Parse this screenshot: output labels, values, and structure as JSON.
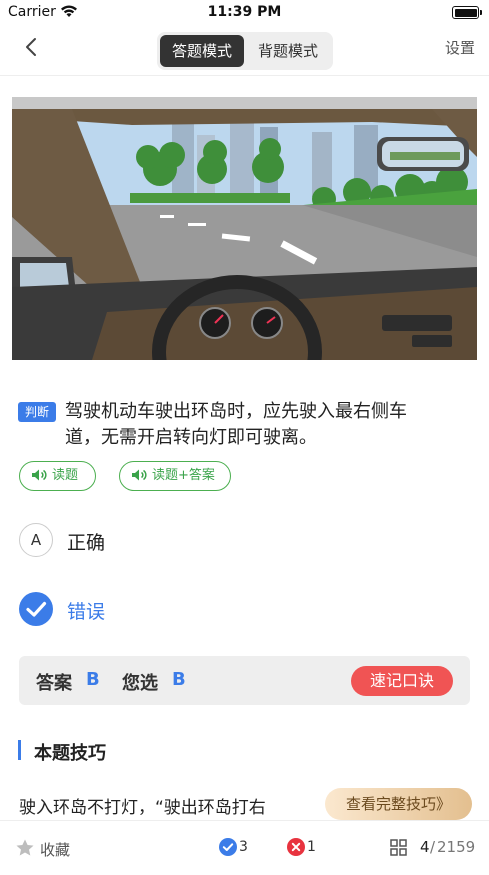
{
  "status_bar": {
    "carrier": "Carrier",
    "time": "11:39 PM"
  },
  "nav": {
    "mode_answer": "答题模式",
    "mode_memorize": "背题模式",
    "active_mode": "答题模式",
    "settings": "设置"
  },
  "question": {
    "type_tag": "判断",
    "text": "驾驶机动车驶出环岛时，应先驶入最右侧车道，无需开启转向灯即可驶离。",
    "read_question": "读题",
    "read_with_answer": "读题+答案"
  },
  "options": [
    {
      "letter": "A",
      "text": "正确",
      "selected": false
    },
    {
      "letter": "B",
      "text": "错误",
      "selected": true
    }
  ],
  "answer": {
    "answer_label": "答案",
    "answer_value": "B",
    "chosen_label": "您选",
    "chosen_value": "B",
    "mnemonic_button": "速记口诀"
  },
  "tips": {
    "title": "本题技巧",
    "text": "驶入环岛不打灯，“驶出环岛打右",
    "view_full": "查看完整技巧》"
  },
  "bottom_bar": {
    "favorite": "收藏",
    "correct_count": "3",
    "wrong_count": "1",
    "current": "4",
    "separator": "/",
    "total": "2159"
  },
  "colors": {
    "accent_blue": "#3b7ce8",
    "green": "#4caf50",
    "red": "#f05454"
  },
  "icons": [
    "wifi-icon",
    "battery-icon",
    "back-icon",
    "speaker-icon",
    "check-icon",
    "star-icon",
    "correct-icon",
    "wrong-icon",
    "grid-icon"
  ]
}
